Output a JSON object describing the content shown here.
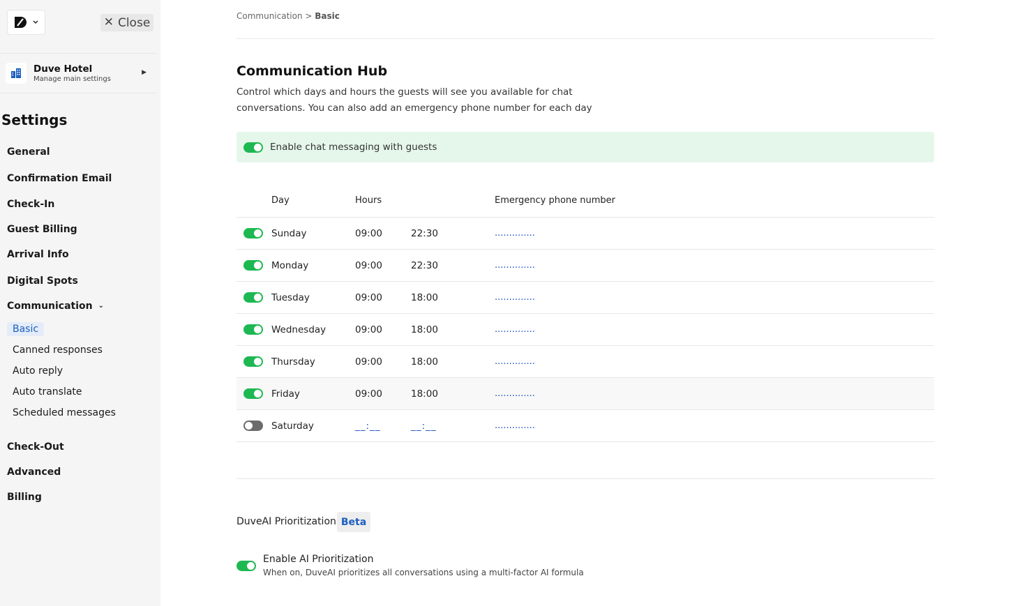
{
  "sidebar": {
    "close_label": "Close",
    "hotel": {
      "name": "Duve Hotel",
      "subtitle": "Manage main settings"
    },
    "settings_title": "Settings",
    "items": [
      {
        "label": "General"
      },
      {
        "label": "Confirmation Email"
      },
      {
        "label": "Check-In"
      },
      {
        "label": "Guest Billing"
      },
      {
        "label": "Arrival Info"
      },
      {
        "label": "Digital Spots"
      },
      {
        "label": "Communication"
      },
      {
        "label": "Check-Out"
      },
      {
        "label": "Advanced"
      },
      {
        "label": "Billing"
      }
    ],
    "communication_sub": [
      {
        "label": "Basic",
        "active": true
      },
      {
        "label": "Canned responses"
      },
      {
        "label": "Auto reply"
      },
      {
        "label": "Auto translate"
      },
      {
        "label": "Scheduled messages"
      }
    ]
  },
  "breadcrumb": {
    "parent": "Communication",
    "separator": " > ",
    "current": "Basic"
  },
  "hub": {
    "title": "Communication Hub",
    "description": "Control which days and hours the guests will see you available for chat conversations. You can also add an emergency phone number for each day",
    "enable_label": "Enable chat messaging with guests",
    "enable_on": true
  },
  "table": {
    "headers": {
      "day": "Day",
      "hours": "Hours",
      "phone": "Emergency phone number"
    },
    "rows": [
      {
        "day": "Sunday",
        "from": "09:00",
        "to": "22:30",
        "phone": "..............",
        "enabled": true
      },
      {
        "day": "Monday",
        "from": "09:00",
        "to": "22:30",
        "phone": "..............",
        "enabled": true
      },
      {
        "day": "Tuesday",
        "from": "09:00",
        "to": "18:00",
        "phone": "..............",
        "enabled": true
      },
      {
        "day": "Wednesday",
        "from": "09:00",
        "to": "18:00",
        "phone": "..............",
        "enabled": true
      },
      {
        "day": "Thursday",
        "from": "09:00",
        "to": "18:00",
        "phone": "..............",
        "enabled": true
      },
      {
        "day": "Friday",
        "from": "09:00",
        "to": "18:00",
        "phone": "..............",
        "enabled": true
      },
      {
        "day": "Saturday",
        "from": "__:__",
        "to": "__:__",
        "phone": "..............",
        "enabled": false
      }
    ]
  },
  "ai": {
    "label": "DuveAI Prioritization",
    "badge": "Beta",
    "toggle_title": "Enable AI Prioritization",
    "toggle_description": "When on, DuveAI prioritizes all conversations using a multi-factor AI formula",
    "enabled": true
  },
  "colors": {
    "accent_green": "#1eb853",
    "link_blue": "#1d5fbf",
    "enable_bg": "#e5f7ea"
  }
}
